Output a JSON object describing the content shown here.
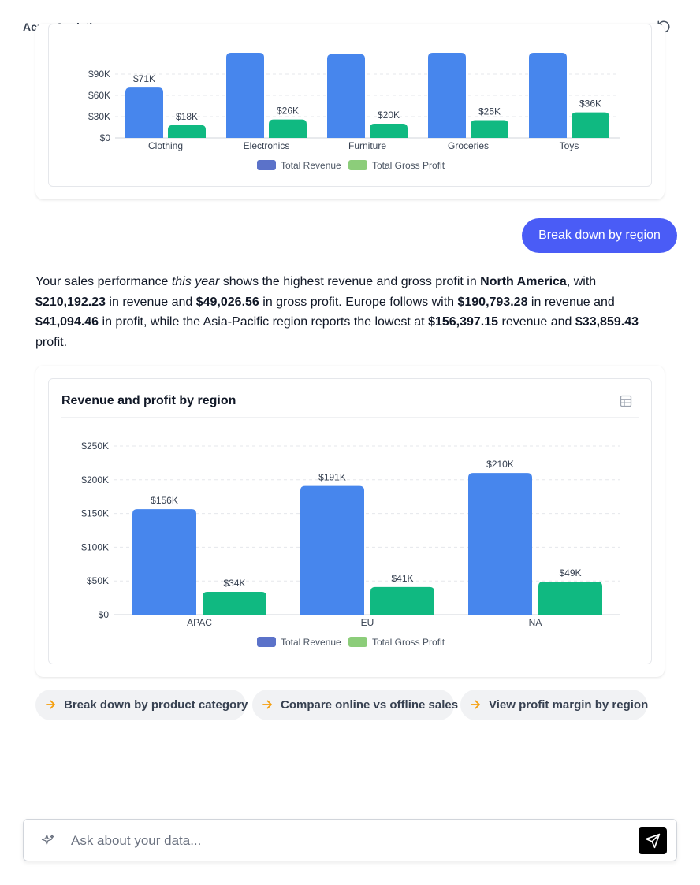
{
  "app": {
    "title": "Acme Analytics"
  },
  "chat": {
    "user_message": "Break down by region",
    "summary": {
      "p1": "Your sales performance ",
      "p1_em": "this year",
      "p2": " shows the highest revenue and gross profit in ",
      "na": "North America",
      "p3": ", with ",
      "na_rev": "$210,192.23",
      "p4": " in revenue and ",
      "na_profit": "$49,026.56",
      "p5": " in gross profit. Europe follows with ",
      "eu_rev": "$190,793.28",
      "p6": " in revenue and ",
      "eu_profit": "$41,094.46",
      "p7": " in profit, while the Asia-Pacific region reports the lowest at ",
      "apac_rev": "$156,397.15",
      "p8": " revenue and ",
      "apac_profit": "$33,859.43",
      "p9": " profit."
    }
  },
  "suggestions": [
    "Break down by product category",
    "Compare online vs offline sales",
    "View profit margin by region"
  ],
  "input": {
    "placeholder": "Ask about your data..."
  },
  "colors": {
    "revenue_bar": "#4786ed",
    "profit_bar": "#10b981",
    "revenue_legend": "#5b72c9",
    "profit_legend": "#8ccd7a",
    "accent": "#4a5cf6",
    "arrow": "#f59e0b"
  },
  "chart_data": [
    {
      "type": "bar",
      "categories": [
        "Clothing",
        "Electronics",
        "Furniture",
        "Groceries",
        "Toys"
      ],
      "series": [
        {
          "name": "Total Revenue",
          "values": [
            71000,
            120000,
            118000,
            140000,
            135000
          ],
          "labels": [
            "$71K",
            "",
            "",
            "",
            ""
          ]
        },
        {
          "name": "Total Gross Profit",
          "values": [
            18000,
            26000,
            20000,
            25000,
            36000
          ],
          "labels": [
            "$18K",
            "$26K",
            "$20K",
            "$25K",
            "$36K"
          ]
        }
      ],
      "yticks": [
        "$0",
        "$30K",
        "$60K",
        "$90K"
      ],
      "ylim": [
        0,
        120000
      ],
      "grid": true,
      "legend": "bottom"
    },
    {
      "type": "bar",
      "title": "Revenue and profit by region",
      "categories": [
        "APAC",
        "EU",
        "NA"
      ],
      "series": [
        {
          "name": "Total Revenue",
          "values": [
            156397.15,
            190793.28,
            210192.23
          ],
          "labels": [
            "$156K",
            "$191K",
            "$210K"
          ]
        },
        {
          "name": "Total Gross Profit",
          "values": [
            33859.43,
            41094.46,
            49026.56
          ],
          "labels": [
            "$34K",
            "$41K",
            "$49K"
          ]
        }
      ],
      "yticks": [
        "$0",
        "$50K",
        "$100K",
        "$150K",
        "$200K",
        "$250K"
      ],
      "ylim": [
        0,
        250000
      ],
      "grid": true,
      "legend": "bottom"
    }
  ]
}
